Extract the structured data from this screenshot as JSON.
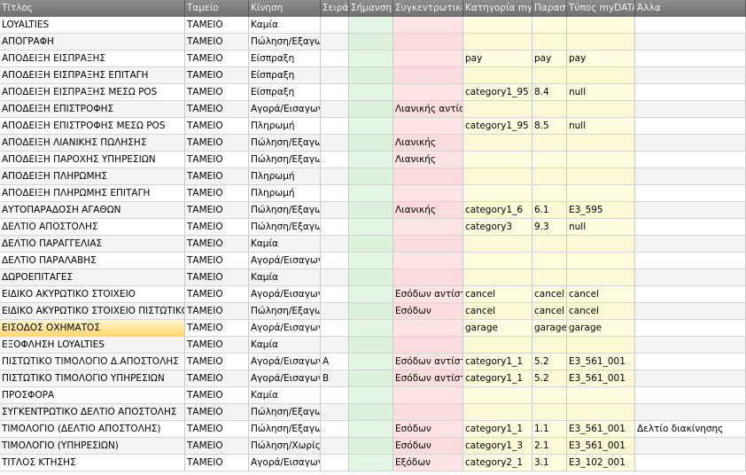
{
  "columns": [
    "Τίτλος",
    "Ταμείο",
    "Κίνηση",
    "Σειρά",
    "Σήμανση",
    "Συγκεντρωτικές",
    "Κατηγορία myDATA",
    "Παραστατικό",
    "Τύπος myDATA",
    "Άλλα"
  ],
  "rows": [
    [
      "LOYALTIES",
      "ΤΑΜΕΙΟ",
      "Καμία",
      "",
      "",
      "",
      "",
      "",
      "",
      ""
    ],
    [
      "ΑΠΟΓΡΑΦΗ",
      "ΤΑΜΕΙΟ",
      "Πώληση/Εξαγωγή",
      "",
      "",
      "",
      "",
      "",
      "",
      ""
    ],
    [
      "ΑΠΟΔΕΙΞΗ ΕΙΣΠΡΑΞΗΣ",
      "ΤΑΜΕΙΟ",
      "Είσπραξη",
      "",
      "",
      "",
      "pay",
      "pay",
      "pay",
      ""
    ],
    [
      "ΑΠΟΔΕΙΞΗ ΕΙΣΠΡΑΞΗΣ ΕΠΙΤΑΓΗ",
      "ΤΑΜΕΙΟ",
      "Είσπραξη",
      "",
      "",
      "",
      "",
      "",
      "",
      ""
    ],
    [
      "ΑΠΟΔΕΙΞΗ ΕΙΣΠΡΑΞΗΣ ΜΕΣΩ POS",
      "ΤΑΜΕΙΟ",
      "Είσπραξη",
      "",
      "",
      "",
      "category1_95",
      "8.4",
      "null",
      ""
    ],
    [
      "ΑΠΟΔΕΙΞΗ ΕΠΙΣΤΡΟΦΗΣ",
      "ΤΑΜΕΙΟ",
      "Αγορά/Εισαγωγή",
      "",
      "",
      "Λιανικής αντίστροφη",
      "",
      "",
      "",
      ""
    ],
    [
      "ΑΠΟΔΕΙΞΗ ΕΠΙΣΤΡΟΦΗΣ ΜΕΣΩ POS",
      "ΤΑΜΕΙΟ",
      "Πληρωμή",
      "",
      "",
      "",
      "category1_95",
      "8.5",
      "null",
      ""
    ],
    [
      "ΑΠΟΔΕΙΞΗ ΛΙΑΝΙΚΗΣ ΠΩΛΗΣΗΣ",
      "ΤΑΜΕΙΟ",
      "Πώληση/Εξαγωγή",
      "",
      "",
      "Λιανικής",
      "",
      "",
      "",
      ""
    ],
    [
      "ΑΠΟΔΕΙΞΗ ΠΑΡΟΧΗΣ ΥΠΗΡΕΣΙΩΝ",
      "ΤΑΜΕΙΟ",
      "Πώληση/Εξαγωγή",
      "",
      "",
      "Λιανικής",
      "",
      "",
      "",
      ""
    ],
    [
      "ΑΠΟΔΕΙΞΗ ΠΛΗΡΩΜΗΣ",
      "ΤΑΜΕΙΟ",
      "Πληρωμή",
      "",
      "",
      "",
      "",
      "",
      "",
      ""
    ],
    [
      "ΑΠΟΔΕΙΞΗ ΠΛΗΡΩΜΗΣ ΕΠΙΤΑΓΗ",
      "ΤΑΜΕΙΟ",
      "Πληρωμή",
      "",
      "",
      "",
      "",
      "",
      "",
      ""
    ],
    [
      "ΑΥΤΟΠΑΡΑΔΟΣΗ ΑΓΑΘΩΝ",
      "ΤΑΜΕΙΟ",
      "Πώληση/Εξαγωγή",
      "",
      "",
      "Λιανικής",
      "category1_6",
      "6.1",
      "E3_595",
      ""
    ],
    [
      "ΔΕΛΤΙΟ ΑΠΟΣΤΟΛΗΣ",
      "ΤΑΜΕΙΟ",
      "Πώληση/Εξαγωγή",
      "",
      "",
      "",
      "category3",
      "9.3",
      "null",
      ""
    ],
    [
      "ΔΕΛΤΙΟ ΠΑΡΑΓΓΕΛΙΑΣ",
      "ΤΑΜΕΙΟ",
      "Καμία",
      "",
      "",
      "",
      "",
      "",
      "",
      ""
    ],
    [
      "ΔΕΛΤΙΟ ΠΑΡΑΛΑΒΗΣ",
      "ΤΑΜΕΙΟ",
      "Αγορά/Εισαγωγή",
      "",
      "",
      "",
      "",
      "",
      "",
      ""
    ],
    [
      "ΔΩΡΟΕΠΙΤΑΓΕΣ",
      "ΤΑΜΕΙΟ",
      "Καμία",
      "",
      "",
      "",
      "",
      "",
      "",
      ""
    ],
    [
      "ΕΙΔΙΚΟ ΑΚΥΡΩΤΙΚΟ ΣΤΟΙΧΕΙΟ",
      "ΤΑΜΕΙΟ",
      "Αγορά/Εισαγωγή",
      "",
      "",
      "Εσόδων αντίστροφη",
      "cancel",
      "cancel",
      "cancel",
      ""
    ],
    [
      "ΕΙΔΙΚΟ ΑΚΥΡΩΤΙΚΟ ΣΤΟΙΧΕΙΟ ΠΙΣΤΩΤΙΚΟ",
      "ΤΑΜΕΙΟ",
      "Πώληση/Εξαγωγή",
      "",
      "",
      "Εσόδων",
      "cancel",
      "cancel",
      "cancel",
      ""
    ],
    [
      "ΕΙΣΟΔΟΣ ΟΧΗΜΑΤΟΣ",
      "ΤΑΜΕΙΟ",
      "Αγορά/Εισαγωγή",
      "",
      "",
      "",
      "garage",
      "garage",
      "garage",
      ""
    ],
    [
      "ΕΞΟΦΛΗΣΗ LOYALTIES",
      "ΤΑΜΕΙΟ",
      "Καμία",
      "",
      "",
      "",
      "",
      "",
      "",
      ""
    ],
    [
      "ΠΙΣΤΩΤΙΚΟ ΤΙΜΟΛΟΓΙΟ Δ.ΑΠΟΣΤΟΛΗΣ",
      "ΤΑΜΕΙΟ",
      "Αγορά/Εισαγωγή",
      "Α",
      "",
      "Εσόδων αντίστροφη",
      "category1_1",
      "5.2",
      "E3_561_001",
      ""
    ],
    [
      "ΠΙΣΤΩΤΙΚΟ ΤΙΜΟΛΟΓΙΟ ΥΠΗΡΕΣΙΩΝ",
      "ΤΑΜΕΙΟ",
      "Αγορά/Εισαγωγή",
      "Β",
      "",
      "Εσόδων αντίστροφη",
      "category1_1",
      "5.2",
      "E3_561_001",
      ""
    ],
    [
      "ΠΡΟΣΦΟΡΑ",
      "ΤΑΜΕΙΟ",
      "Καμία",
      "",
      "",
      "",
      "",
      "",
      "",
      ""
    ],
    [
      "ΣΥΓΚΕΝΤΡΩΤΙΚΟ ΔΕΛΤΙΟ ΑΠΟΣΤΟΛΗΣ",
      "ΤΑΜΕΙΟ",
      "Πώληση/Εξαγωγή",
      "",
      "",
      "",
      "",
      "",
      "",
      ""
    ],
    [
      "ΤΙΜΟΛΟΓΙΟ (ΔΕΛΤΙΟ ΑΠΟΣΤΟΛΗΣ)",
      "ΤΑΜΕΙΟ",
      "Πώληση/Εξαγωγή",
      "",
      "",
      "Εσόδων",
      "category1_1",
      "1.1",
      "E3_561_001",
      "Δελτίο διακίνησης"
    ],
    [
      "ΤΙΜΟΛΟΓΙΟ (ΥΠΗΡΕΣΙΩΝ)",
      "ΤΑΜΕΙΟ",
      "Πώληση/Χωρίς δ",
      "",
      "",
      "Εσόδων",
      "category1_3",
      "2.1",
      "E3_561_001",
      ""
    ],
    [
      "ΤΙΤΛΟΣ ΚΤΗΣΗΣ",
      "ΤΑΜΕΙΟ",
      "Αγορά/Εισαγωγή",
      "",
      "",
      "Εξόδων",
      "category2_1",
      "3.1",
      "E3_102_001",
      ""
    ]
  ],
  "selected_cell": {
    "row": 18,
    "col": 0
  },
  "colors": {
    "header_bg": "#7f7f7f",
    "green_col": "#e3f6e3",
    "pink_col": "#fde3e3",
    "yellow_col": "#fffde0",
    "selected_cell": "#ffd86a"
  }
}
